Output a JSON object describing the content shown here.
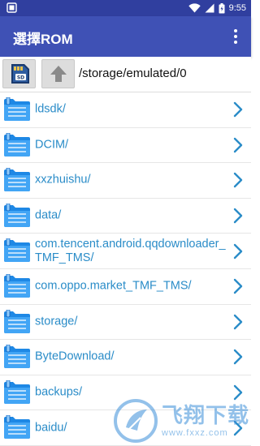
{
  "status_bar": {
    "time": "9:55"
  },
  "app_bar": {
    "title": "選擇ROM",
    "menu_icon": "more-vert-icon"
  },
  "path_bar": {
    "sd_button_icon": "sd-card-icon",
    "up_button_icon": "arrow-up-icon",
    "current_path": "/storage/emulated/0"
  },
  "folders": [
    {
      "name": "ldsdk/"
    },
    {
      "name": "DCIM/"
    },
    {
      "name": "xxzhuishu/"
    },
    {
      "name": "data/"
    },
    {
      "name": "com.tencent.android.qqdownloader_TMF_TMS/"
    },
    {
      "name": "com.oppo.market_TMF_TMS/"
    },
    {
      "name": "storage/"
    },
    {
      "name": "ByteDownload/"
    },
    {
      "name": "backups/"
    },
    {
      "name": "baidu/"
    }
  ],
  "watermark": {
    "text": "飞翔下载",
    "url": "www.fxxz.com"
  },
  "colors": {
    "primary": "#3f51b5",
    "primary_dark": "#303f9f",
    "accent": "#2a8cc8"
  }
}
